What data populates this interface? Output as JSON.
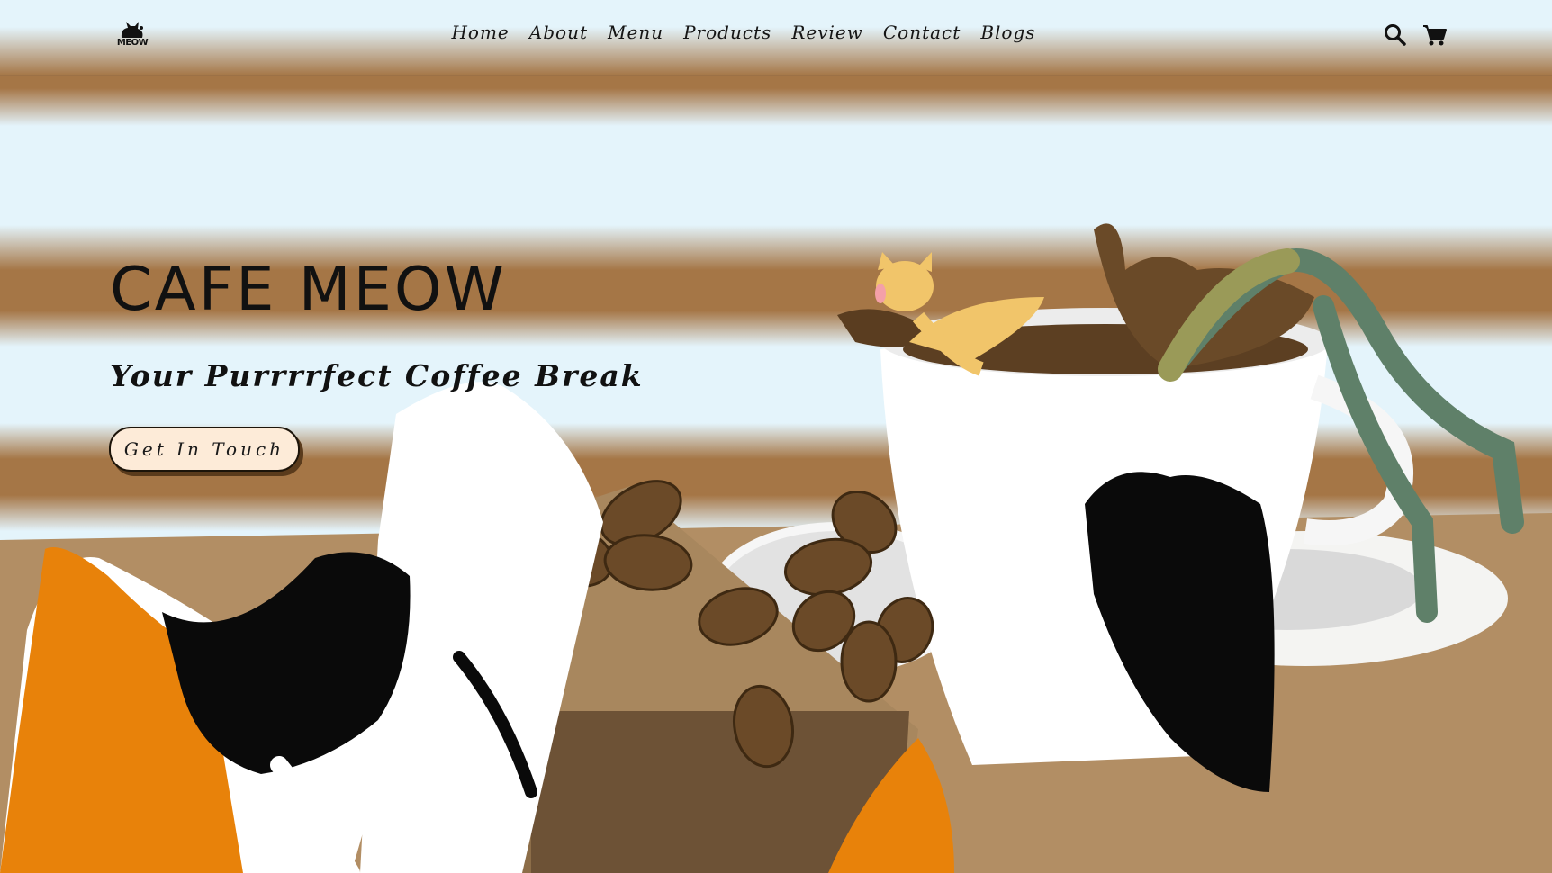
{
  "brand": {
    "logo_text": "MEOW"
  },
  "nav": {
    "links": [
      "Home",
      "About",
      "Menu",
      "Products",
      "Review",
      "Contact",
      "Blogs"
    ]
  },
  "icons": {
    "search": "search-icon",
    "cart": "cart-icon",
    "logo": "cat-logo-icon"
  },
  "hero": {
    "title": "CAFE MEOW",
    "subtitle": "Your Purrrrfect Coffee Break",
    "cta_label": "Get In Touch"
  },
  "colors": {
    "sky": "#e4f4fb",
    "stripe_brown": "#a57646",
    "table": "#b28e64",
    "cat_orange": "#e8820a",
    "cat_black": "#0a0a0a",
    "cta_fill": "#fdebd8",
    "coffee": "#5c3f22"
  }
}
